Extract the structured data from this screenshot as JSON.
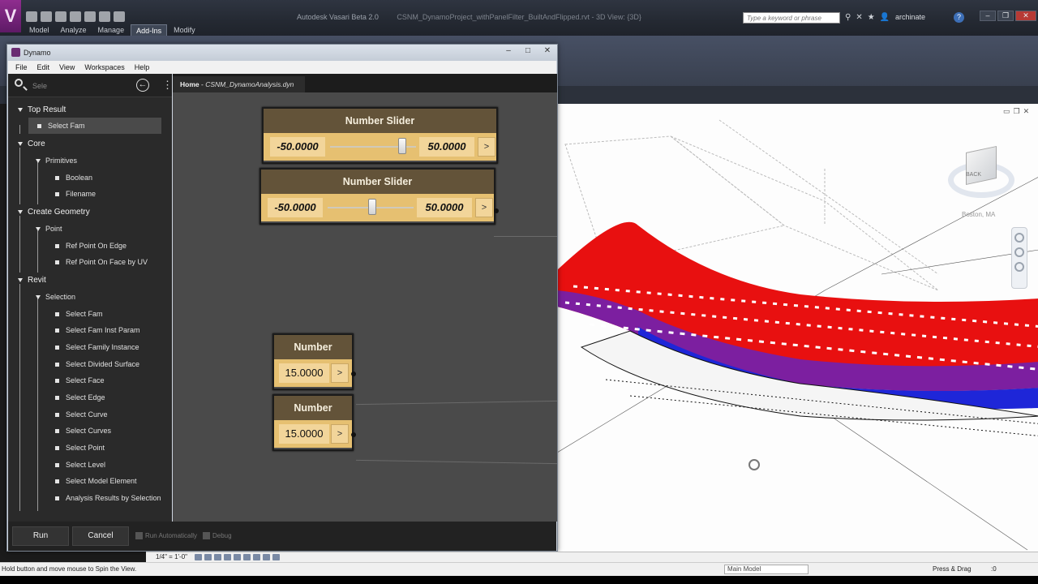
{
  "revit": {
    "app_title": "Autodesk Vasari Beta 2.0",
    "file_title": "CSNM_DynamoProject_withPanelFilter_BuiltAndFlipped.rvt - 3D View: {3D}",
    "search_placeholder": "Type a keyword or phrase",
    "user": "archinate",
    "help": "?",
    "ribbon_tabs": [
      "Model",
      "Analyze",
      "Manage",
      "Add-Ins",
      "Modify"
    ],
    "active_tab": "Add-Ins",
    "icons": [
      "binoculars-icon",
      "exchange-icon",
      "star-icon",
      "user-icon",
      "help-icon"
    ]
  },
  "view3d": {
    "location": "Boston, MA",
    "viewcube_face": "BACK",
    "colors": {
      "red": "#e81010",
      "purple": "#7c1fa0",
      "blue": "#1e26d8"
    }
  },
  "dynamo": {
    "title": "Dynamo",
    "menu": [
      "File",
      "Edit",
      "View",
      "Workspaces",
      "Help"
    ],
    "search": {
      "value": "Sele",
      "placeholder": "Search"
    },
    "tab": {
      "home": "Home",
      "separator": " - ",
      "file": "CSNM_DynamoAnalysis.dyn"
    },
    "library": {
      "top_result": "Top Result",
      "top_result_item": "Select Fam",
      "core": "Core",
      "primitives": "Primitives",
      "primitives_items": [
        "Boolean",
        "Filename"
      ],
      "create_geometry": "Create Geometry",
      "point": "Point",
      "point_items": [
        "Ref Point On Edge",
        "Ref Point On Face by UV"
      ],
      "revit": "Revit",
      "selection": "Selection",
      "selection_items": [
        "Select Fam",
        "Select Fam Inst Param",
        "Select Family Instance",
        "Select Divided Surface",
        "Select Face",
        "Select Edge",
        "Select Curve",
        "Select Curves",
        "Select Point",
        "Select Level",
        "Select Model Element",
        "Analysis Results by Selection"
      ]
    },
    "nodes": {
      "slider1": {
        "title": "Number Slider",
        "min": "-50.0000",
        "max": "50.0000",
        "level": 0.84,
        "expand": ">"
      },
      "slider2": {
        "title": "Number Slider",
        "min": "-50.0000",
        "max": "50.0000",
        "level": 0.52,
        "expand": ">"
      },
      "number1": {
        "title": "Number",
        "value": "15.0000",
        "expand": ">"
      },
      "number2": {
        "title": "Number",
        "value": "15.0000",
        "expand": ">"
      }
    },
    "footer": {
      "run": "Run",
      "cancel": "Cancel",
      "run_automatically": "Run Automatically",
      "debug": "Debug"
    }
  },
  "statusbar": {
    "hint": "Hold button and move mouse to Spin the View.",
    "scale": "1/4\" = 1'-0\"",
    "model": "Main Model",
    "press_drag": "Press & Drag",
    "filter_count": ":0"
  }
}
